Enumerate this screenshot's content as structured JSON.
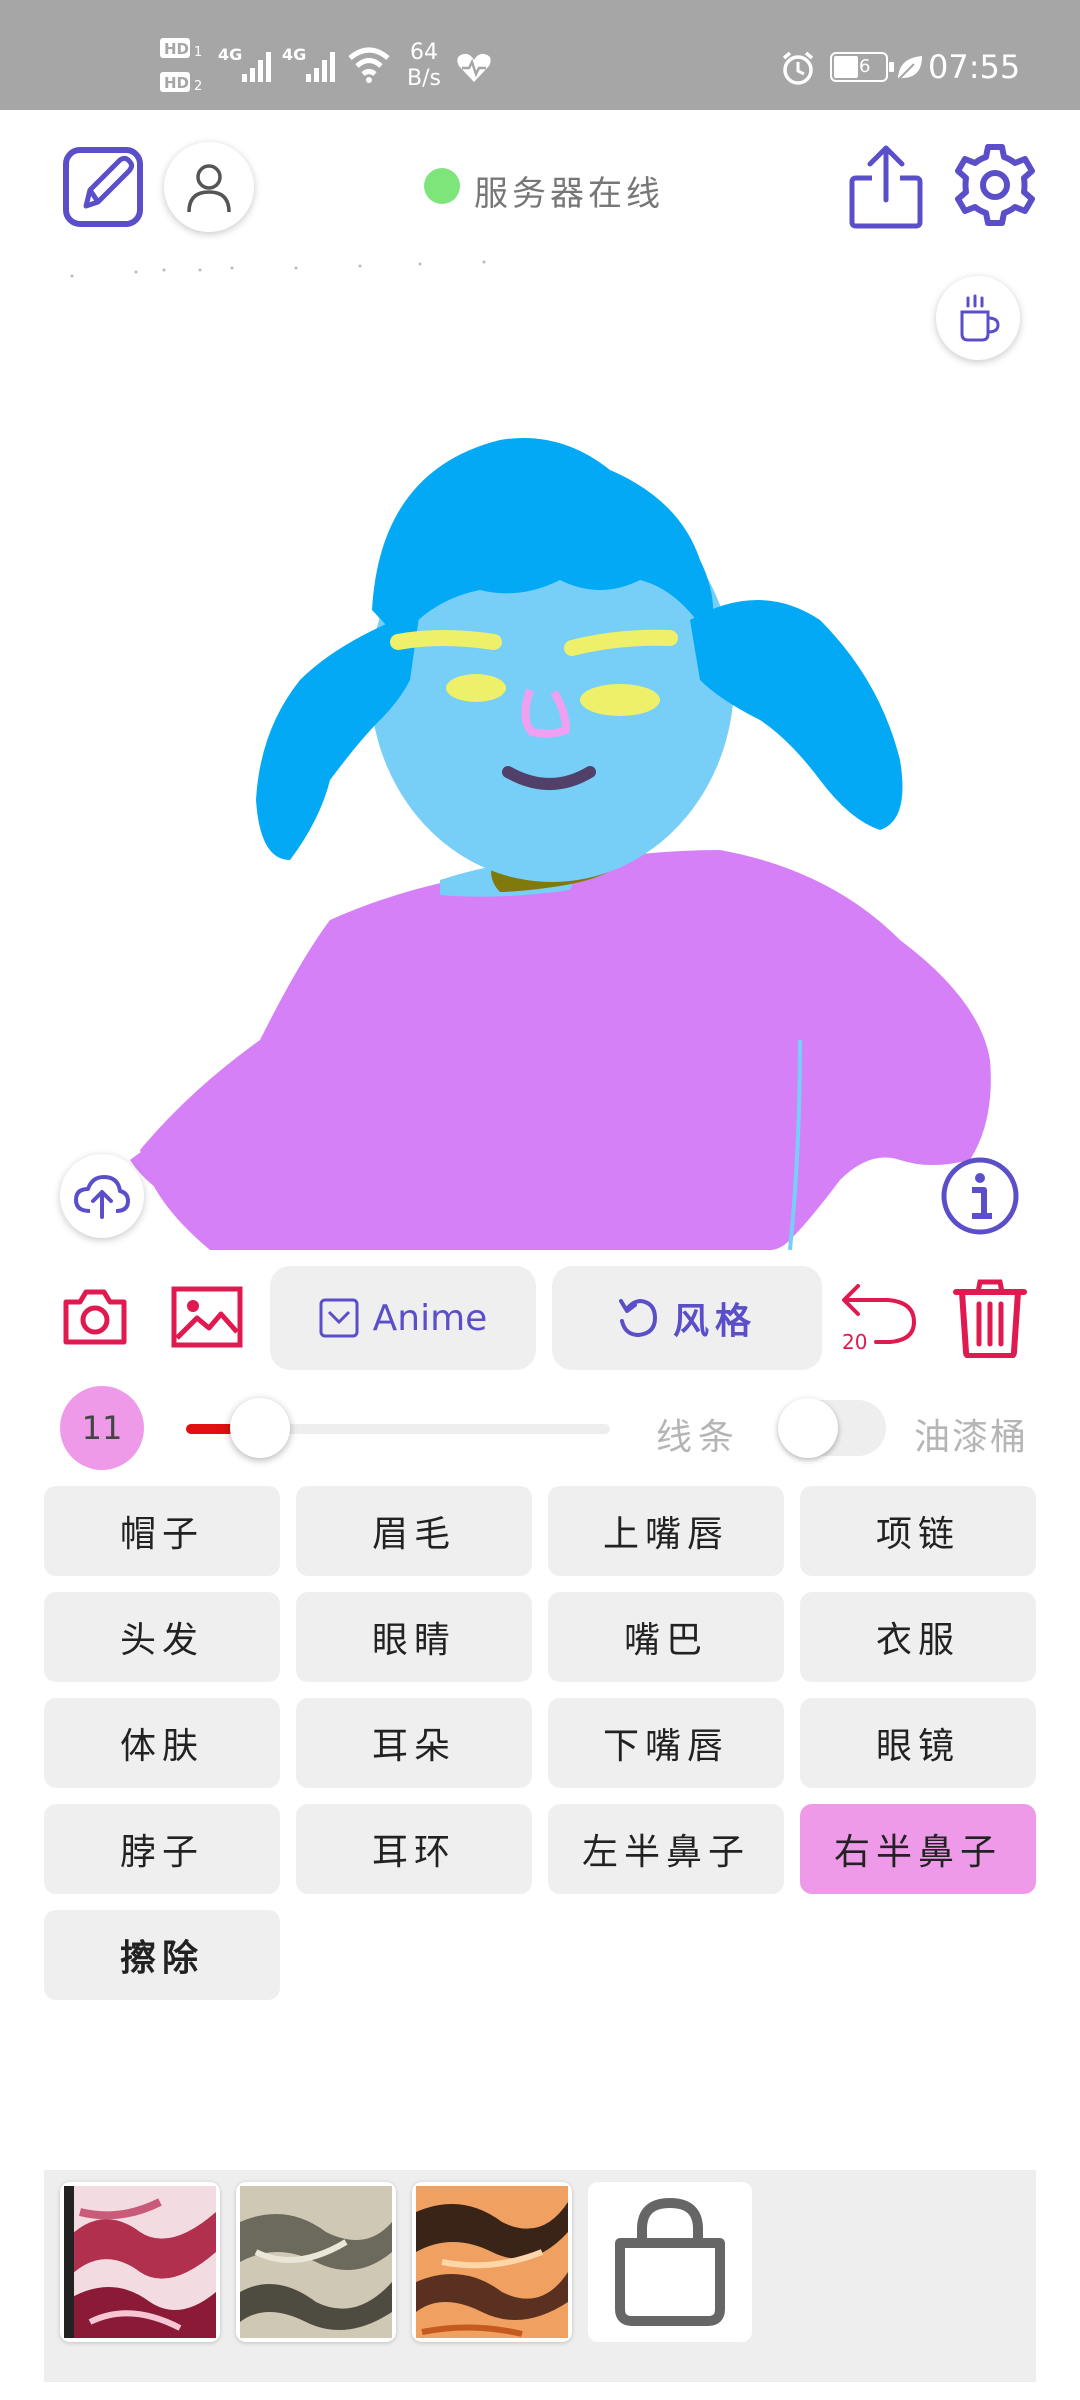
{
  "status_bar": {
    "hd1": "HD",
    "hd2": "HD",
    "sim1": "1",
    "sim2": "2",
    "net1": "4G",
    "net2": "4G",
    "speed_value": "64",
    "speed_unit": "B/s",
    "battery": "46",
    "time": "07:55"
  },
  "header": {
    "server_status": "服务器在线"
  },
  "toolbar": {
    "anime_label": "Anime",
    "style_label": "风格",
    "undo_count": "20"
  },
  "brush": {
    "size": "11",
    "slider_fraction": 0.15,
    "line_label": "线条",
    "bucket_label": "油漆桶",
    "bucket_enabled": false
  },
  "parts": [
    {
      "label": "帽子"
    },
    {
      "label": "眉毛"
    },
    {
      "label": "上嘴唇"
    },
    {
      "label": "项链"
    },
    {
      "label": "头发"
    },
    {
      "label": "眼睛"
    },
    {
      "label": "嘴巴"
    },
    {
      "label": "衣服"
    },
    {
      "label": "体肤"
    },
    {
      "label": "耳朵"
    },
    {
      "label": "下嘴唇"
    },
    {
      "label": "眼镜"
    },
    {
      "label": "脖子"
    },
    {
      "label": "耳环"
    },
    {
      "label": "左半鼻子"
    },
    {
      "label": "右半鼻子",
      "selected": true
    },
    {
      "label": "擦除"
    }
  ],
  "colors": {
    "accent": "#5b4fc9",
    "danger": "#e0194f",
    "selected": "#ee9ae9",
    "server_online": "#7ee57a",
    "hair": "#03a9f4",
    "skin": "#77cff8",
    "shirt": "#d580f7"
  },
  "icons": {
    "edit": "edit-icon",
    "profile": "user-icon",
    "share": "share-icon",
    "settings": "gear-icon",
    "coffee": "coffee-icon",
    "upload": "cloud-upload-icon",
    "info": "info-icon",
    "camera": "camera-icon",
    "gallery": "image-icon",
    "undo": "undo-icon",
    "delete": "trash-icon",
    "more_textures": "bag-icon"
  }
}
